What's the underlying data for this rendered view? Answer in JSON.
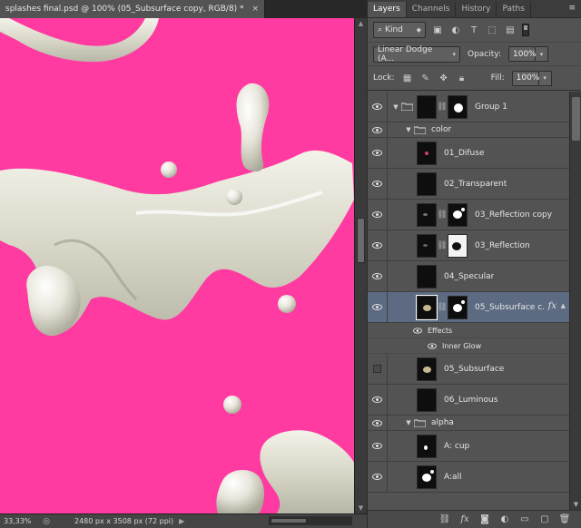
{
  "document": {
    "tab_title": "splashes final.psd @ 100% (05_Subsurface copy, RGB/8) *",
    "close_symbol": "×",
    "zoom": "33,33%",
    "doc_info": "2480 px x 3508 px (72 ppi)",
    "canvas_color": "#ff3aa0"
  },
  "panel": {
    "tabs": [
      {
        "label": "Layers",
        "active": true
      },
      {
        "label": "Channels",
        "active": false
      },
      {
        "label": "History",
        "active": false
      },
      {
        "label": "Paths",
        "active": false
      }
    ],
    "filter_kind": "Kind",
    "blend_mode": "Linear Dodge (A...",
    "opacity_label": "Opacity:",
    "opacity_value": "100%",
    "lock_label": "Lock:",
    "fill_label": "Fill:",
    "fill_value": "100%"
  },
  "layers": {
    "group1": "Group 1",
    "color": "color",
    "l01": "01_Difuse",
    "l02": "02_Transparent",
    "l03a": "03_Reflection copy",
    "l03b": "03_Reflection",
    "l04": "04_Specular",
    "l05a": "05_Subsurface c...",
    "effects": "Effects",
    "inner_glow": "Inner Glow",
    "l05b": "05_Subsurface",
    "l06": "06_Luminous",
    "alpha": "alpha",
    "a_cup": "A: cup",
    "a_all": "A:all"
  },
  "icons": {
    "eye": "eye-icon",
    "fx": "fx"
  }
}
